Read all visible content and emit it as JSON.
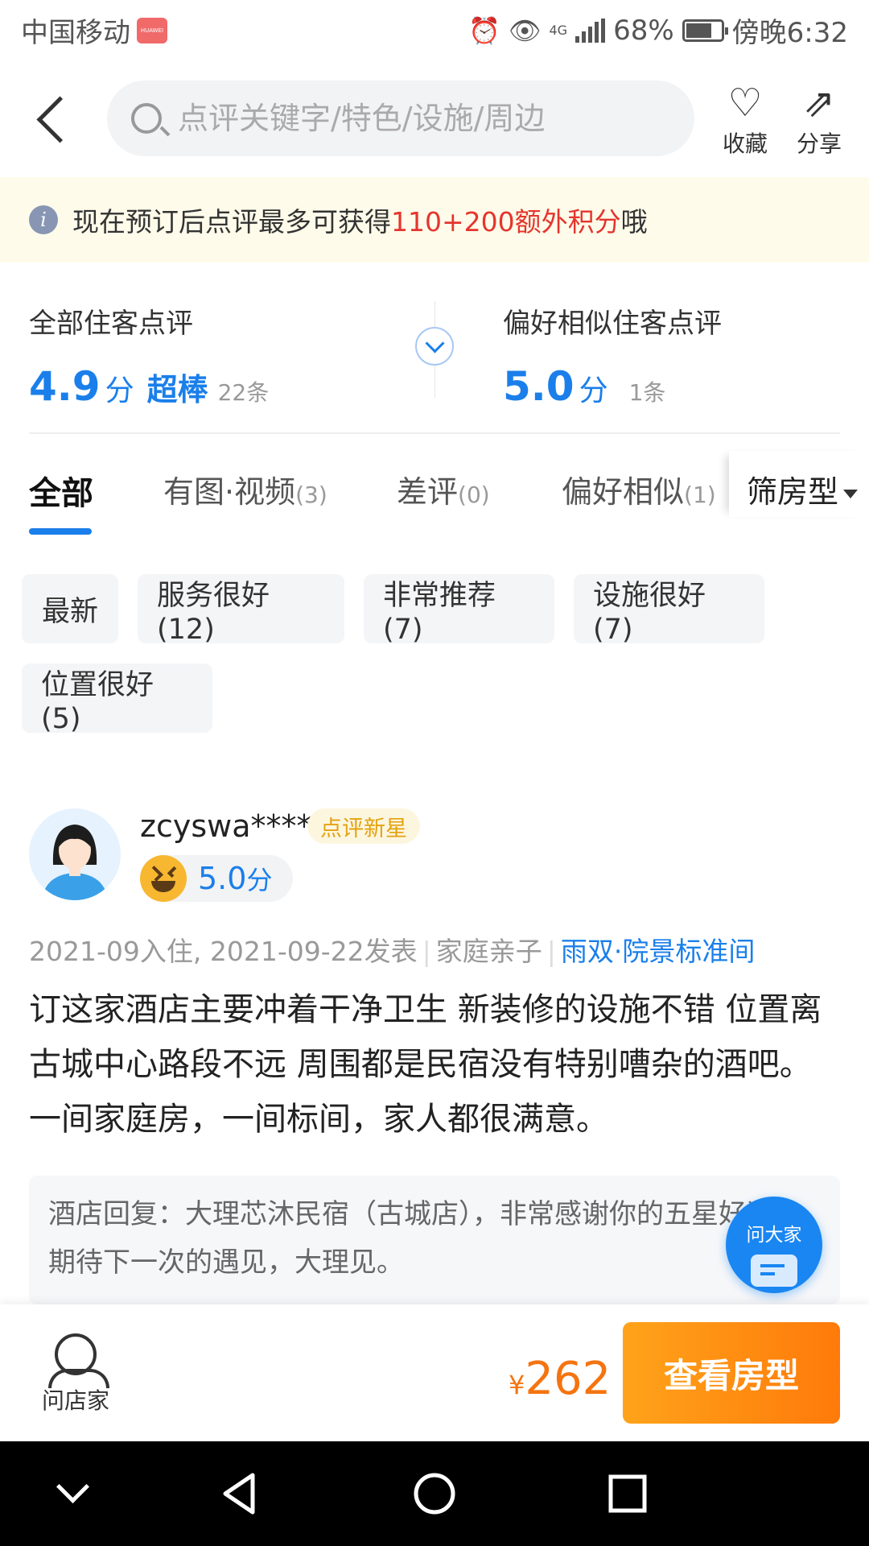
{
  "status_bar": {
    "carrier": "中国移动",
    "network": "4G",
    "battery": "68%",
    "time": "傍晚6:32"
  },
  "header": {
    "search_placeholder": "点评关键字/特色/设施/周边",
    "favorite_label": "收藏",
    "share_label": "分享"
  },
  "notice": {
    "prefix": "现在预订后点评最多可获得",
    "highlight": "110+200额外积分",
    "suffix": "哦"
  },
  "scores": {
    "all": {
      "title": "全部住客点评",
      "score": "4.9",
      "unit": "分",
      "word": "超棒",
      "count": "22条"
    },
    "similar": {
      "title": "偏好相似住客点评",
      "score": "5.0",
      "unit": "分",
      "count": "1条"
    }
  },
  "tabs": [
    {
      "label": "全部",
      "count": ""
    },
    {
      "label": "有图·视频",
      "count": "(3)"
    },
    {
      "label": "差评",
      "count": "(0)"
    },
    {
      "label": "偏好相似",
      "count": "(1)"
    }
  ],
  "filter_label": "筛房型",
  "chips": [
    "最新",
    "服务很好(12)",
    "非常推荐(7)",
    "设施很好(7)",
    "位置很好(5)"
  ],
  "review": {
    "username": "zcyswa****",
    "badge": "点评新星",
    "rating": "5.0",
    "rating_unit": "分",
    "stay": "2021-09入住, 2021-09-22发表",
    "trip_type": "家庭亲子",
    "room": "雨双·院景标准间",
    "text": "订这家酒店主要冲着干净卫生 新装修的设施不错 位置离古城中心路段不远   周围都是民宿没有特别嘈杂的酒吧。一间家庭房，一间标间，家人都很满意。",
    "reply": "酒店回复：大理芯沐民宿（古城店），非常感谢你的五星好评，期待下一次的遇见，大理见。"
  },
  "ask_fab_label": "问大家",
  "bottom": {
    "ask_host_label": "问店家",
    "currency": "¥",
    "price": "262",
    "book_label": "查看房型"
  },
  "colors": {
    "accent": "#1a7fea",
    "highlight": "#e5352d",
    "price": "#f5740f",
    "cta": "#ff8c12"
  }
}
